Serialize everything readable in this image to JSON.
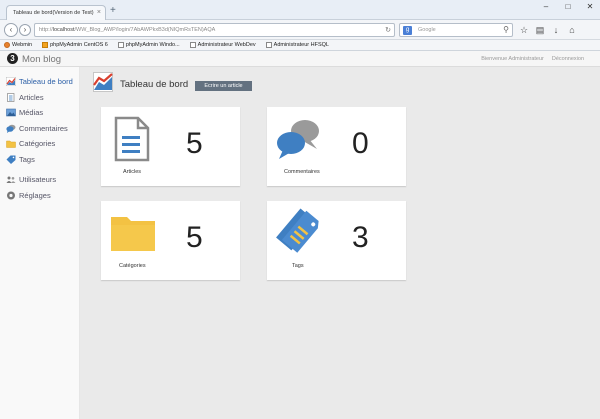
{
  "browser": {
    "tab_title": "Tableau de bord(Version de Test)",
    "url_prefix": "http://",
    "url_host": "localhost",
    "url_path": "/WW_Blog_AWP/login/7AbAWPkxB3d(NIQmRsTEN)AQA",
    "search_placeholder": "Google",
    "bookmarks": [
      {
        "label": "Webmin"
      },
      {
        "label": "phpMyAdmin CentOS 6"
      },
      {
        "label": "phpMyAdmin Windo..."
      },
      {
        "label": "Administrateur WebDev"
      },
      {
        "label": "Administrateur HFSQL"
      }
    ]
  },
  "app": {
    "logo_glyph": "3",
    "site_title": "Mon blog",
    "user_link": "Bienvenue Administrateur",
    "logout_link": "Déconnexion"
  },
  "sidebar": {
    "items": [
      {
        "label": "Tableau de bord",
        "icon": "dashboard-icon"
      },
      {
        "label": "Articles",
        "icon": "document-icon"
      },
      {
        "label": "Médias",
        "icon": "image-icon"
      },
      {
        "label": "Commentaires",
        "icon": "comment-icon"
      },
      {
        "label": "Catégories",
        "icon": "folder-icon"
      },
      {
        "label": "Tags",
        "icon": "tag-icon"
      },
      {
        "label": "Utilisateurs",
        "icon": "users-icon"
      },
      {
        "label": "Réglages",
        "icon": "settings-icon"
      }
    ]
  },
  "main": {
    "title": "Tableau de bord",
    "write_button": "Ecrire un article",
    "cards": [
      {
        "label": "Articles",
        "count": "5",
        "icon": "article-icon"
      },
      {
        "label": "Commentaires",
        "count": "0",
        "icon": "comments-icon"
      },
      {
        "label": "Catégories",
        "count": "5",
        "icon": "folder-icon"
      },
      {
        "label": "Tags",
        "count": "3",
        "icon": "tags-icon"
      }
    ]
  },
  "colors": {
    "blue": "#3f7fc2",
    "yellow": "#f3c243",
    "gray": "#8a8a8a",
    "accent_red": "#d9402f"
  }
}
